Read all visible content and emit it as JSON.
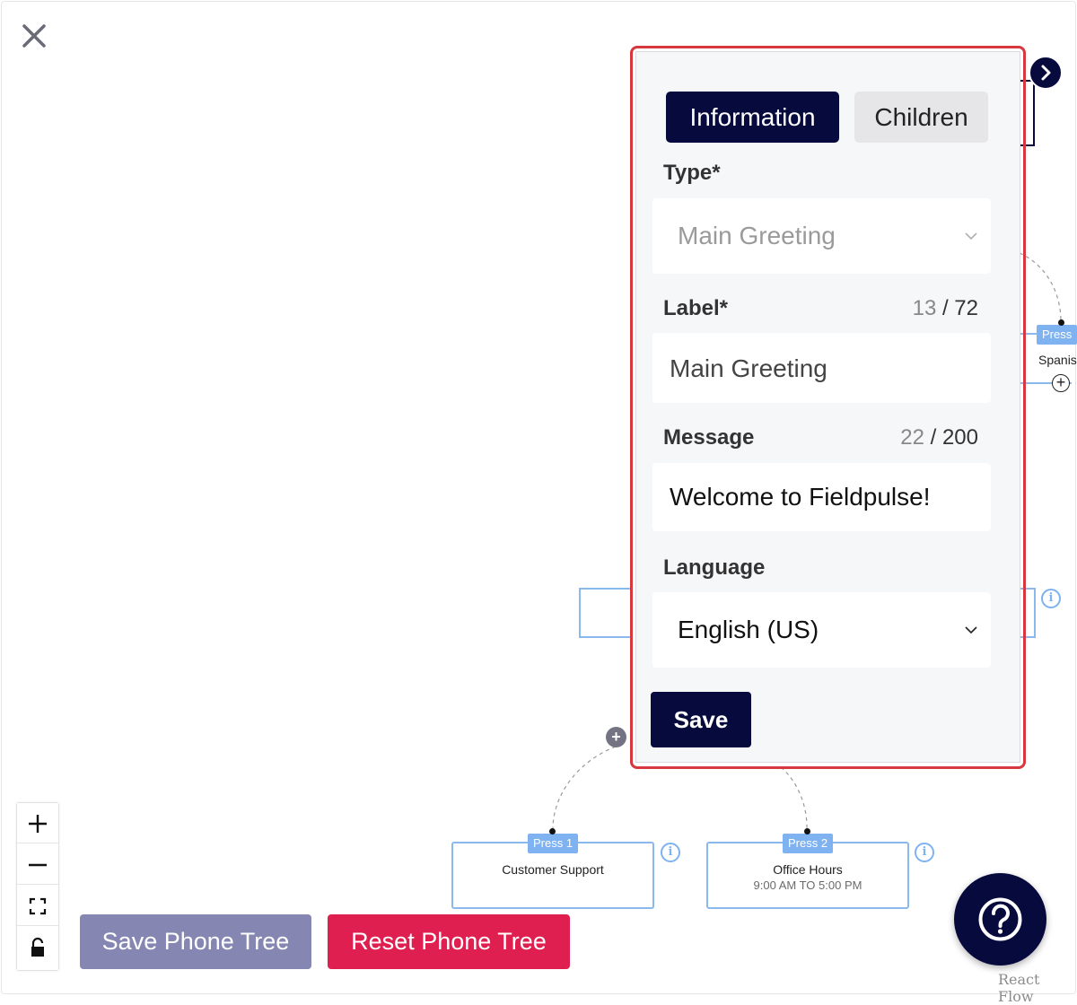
{
  "panel": {
    "tabs": [
      {
        "label": "Information",
        "active": true
      },
      {
        "label": "Children",
        "active": false
      }
    ],
    "type": {
      "label": "Type*",
      "value": "Main Greeting"
    },
    "label_field": {
      "label": "Label*",
      "count": "13",
      "max": "/ 72",
      "value": "Main Greeting"
    },
    "message": {
      "label": "Message",
      "count": "22",
      "max": "/ 200",
      "value": "Welcome to Fieldpulse!"
    },
    "language": {
      "label": "Language",
      "value": "English (US)"
    },
    "save_label": "Save"
  },
  "nodes": {
    "customer_support": {
      "tag": "Press 1",
      "title": "Customer Support"
    },
    "office_hours": {
      "tag": "Press 2",
      "title": "Office Hours",
      "subtitle": "9:00 AM TO 5:00 PM"
    },
    "spanish_partial": {
      "tag": "Press",
      "title": "Spanis"
    }
  },
  "footer": {
    "save_tree_label": "Save Phone Tree",
    "reset_tree_label": "Reset Phone Tree"
  },
  "watermark": "React Flow",
  "colors": {
    "navy": "#070a3d",
    "accent_red": "#de1f4f",
    "muted_purple": "#8587b2",
    "node_blue": "#7fb2f0"
  },
  "icons": [
    "close-icon",
    "chevron-right-icon",
    "chevron-down-icon",
    "info-icon",
    "plus-icon",
    "zoom-in-icon",
    "zoom-out-icon",
    "fit-view-icon",
    "lock-icon",
    "help-icon"
  ]
}
